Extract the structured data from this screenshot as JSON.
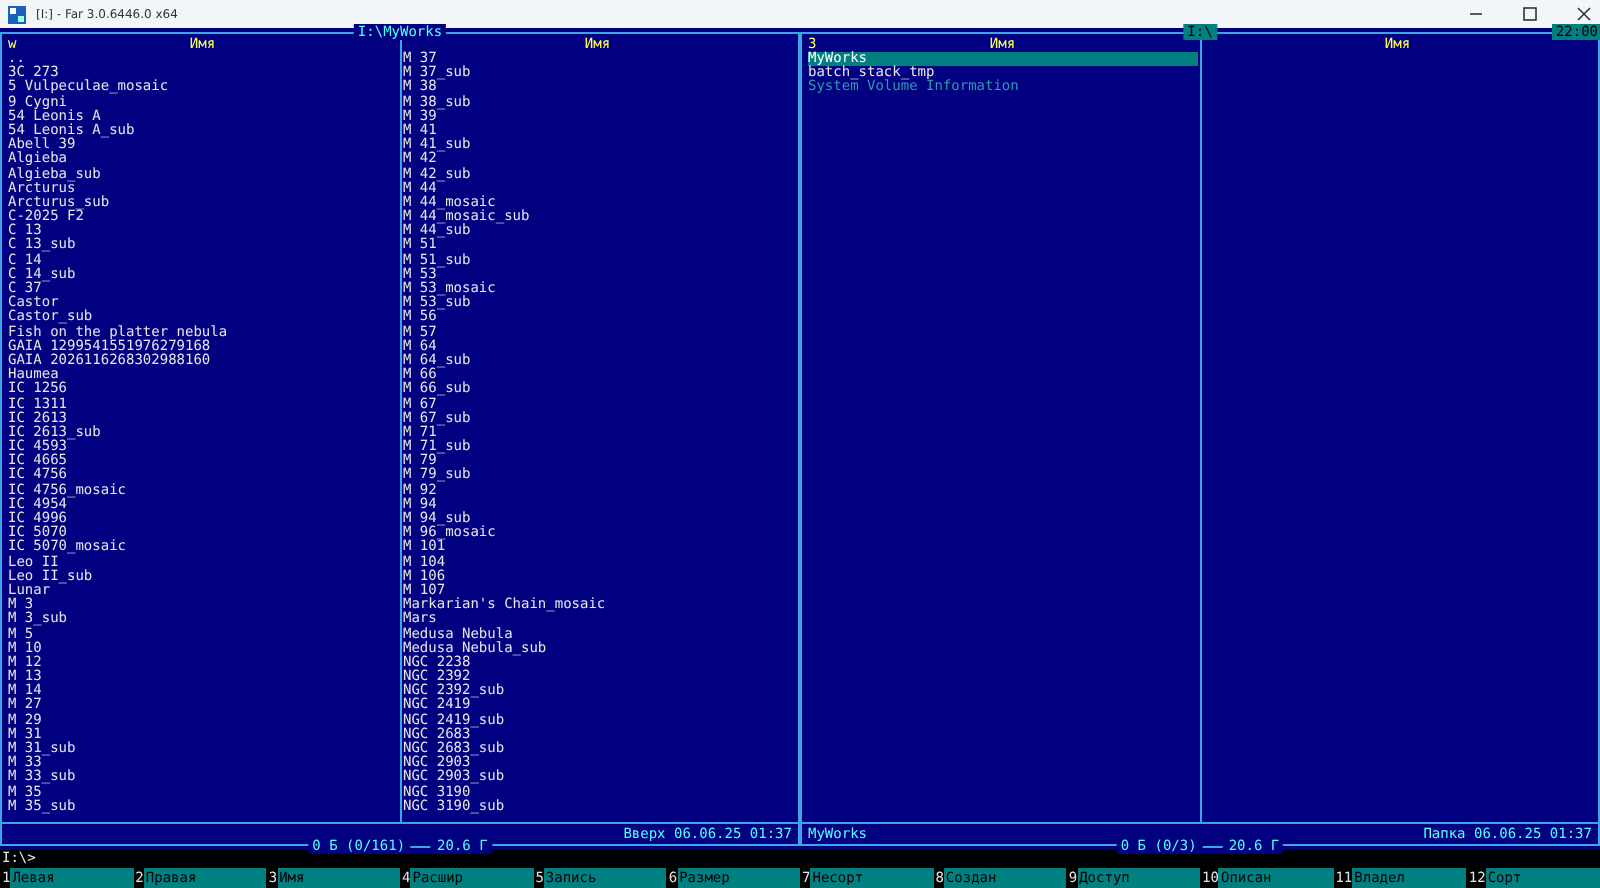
{
  "window": {
    "title": "[I:] - Far 3.0.6446.0 x64"
  },
  "panels": [
    {
      "path": "I:\\MyWorks",
      "active": false,
      "columns": [
        {
          "marker": "w",
          "heading": "Имя",
          "items": [
            "..",
            "3C 273",
            "5 Vulpeculae_mosaic",
            "9 Cygni",
            "54 Leonis A",
            "54 Leonis A_sub",
            "Abell 39",
            "Algieba",
            "Algieba_sub",
            "Arcturus",
            "Arcturus_sub",
            "C-2025 F2",
            "C 13",
            "C 13_sub",
            "C 14",
            "C 14_sub",
            "C 37",
            "Castor",
            "Castor_sub",
            "Fish on the platter nebula",
            "GAIA 1299541551976279168",
            "GAIA 2026116268302988160",
            "Haumea",
            "IC 1256",
            "IC 1311",
            "IC 2613",
            "IC 2613_sub",
            "IC 4593",
            "IC 4665",
            "IC 4756",
            "IC 4756_mosaic",
            "IC 4954",
            "IC 4996",
            "IC 5070",
            "IC 5070_mosaic",
            "Leo II",
            "Leo II_sub",
            "Lunar",
            "M 3",
            "M 3_sub",
            "M 5",
            "M 10",
            "M 12",
            "M 13",
            "M 14",
            "M 27",
            "M 29",
            "M 31",
            "M 31_sub",
            "M 33",
            "M 33_sub",
            "M 35",
            "M 35_sub"
          ]
        },
        {
          "heading": "Имя",
          "items": [
            "M 37",
            "M 37_sub",
            "M 38",
            "M 38_sub",
            "M 39",
            "M 41",
            "M 41_sub",
            "M 42",
            "M 42_sub",
            "M 44",
            "M 44_mosaic",
            "M 44_mosaic_sub",
            "M 44_sub",
            "M 51",
            "M 51_sub",
            "M 53",
            "M 53_mosaic",
            "M 53_sub",
            "M 56",
            "M 57",
            "M 64",
            "M 64_sub",
            "M 66",
            "M 66_sub",
            "M 67",
            "M 67_sub",
            "M 71",
            "M 71_sub",
            "M 79",
            "M 79_sub",
            "M 92",
            "M 94",
            "M 94_sub",
            "M 96_mosaic",
            "M 101",
            "M 104",
            "M 106",
            "M 107",
            "Markarian's Chain_mosaic",
            "Mars",
            "Medusa Nebula",
            "Medusa Nebula_sub",
            "NGC 2238",
            "NGC 2392",
            "NGC 2392_sub",
            "NGC 2419",
            "NGC 2419_sub",
            "NGC 2683",
            "NGC 2683_sub",
            "NGC 2903",
            "NGC 2903_sub",
            "NGC 3190",
            "NGC 3190_sub"
          ]
        }
      ],
      "info": {
        "detail": "Вверх 06.06.25 01:37"
      },
      "status_count": "0 Б (0/161)",
      "status_space": "20.6 Г"
    },
    {
      "path": "I:\\",
      "active": true,
      "clock": "22:00",
      "columns": [
        {
          "marker": "3",
          "heading": "Имя",
          "items": [
            {
              "name": "MyWorks",
              "kind": "folder",
              "selected": true
            },
            {
              "name": "batch_stack_tmp",
              "kind": "folder",
              "selected": false
            },
            {
              "name": "System Volume Information",
              "kind": "hidden",
              "selected": false
            }
          ]
        },
        {
          "heading": "Имя"
        }
      ],
      "info": {
        "name": "MyWorks",
        "detail": "Папка 06.06.25 01:37"
      },
      "status_count": "0 Б (0/3)",
      "status_space": "20.6 Г"
    }
  ],
  "command_line": "I:\\>",
  "keys": [
    {
      "num": "1",
      "label": "Левая"
    },
    {
      "num": "2",
      "label": "Правая"
    },
    {
      "num": "3",
      "label": "Имя"
    },
    {
      "num": "4",
      "label": "Расшир"
    },
    {
      "num": "5",
      "label": "Запись"
    },
    {
      "num": "6",
      "label": "Размер"
    },
    {
      "num": "7",
      "label": "Несорт"
    },
    {
      "num": "8",
      "label": "Создан"
    },
    {
      "num": "9",
      "label": "Доступ"
    },
    {
      "num": "10",
      "label": "Описан"
    },
    {
      "num": "11",
      "label": "Владел"
    },
    {
      "num": "12",
      "label": "Сорт"
    }
  ]
}
